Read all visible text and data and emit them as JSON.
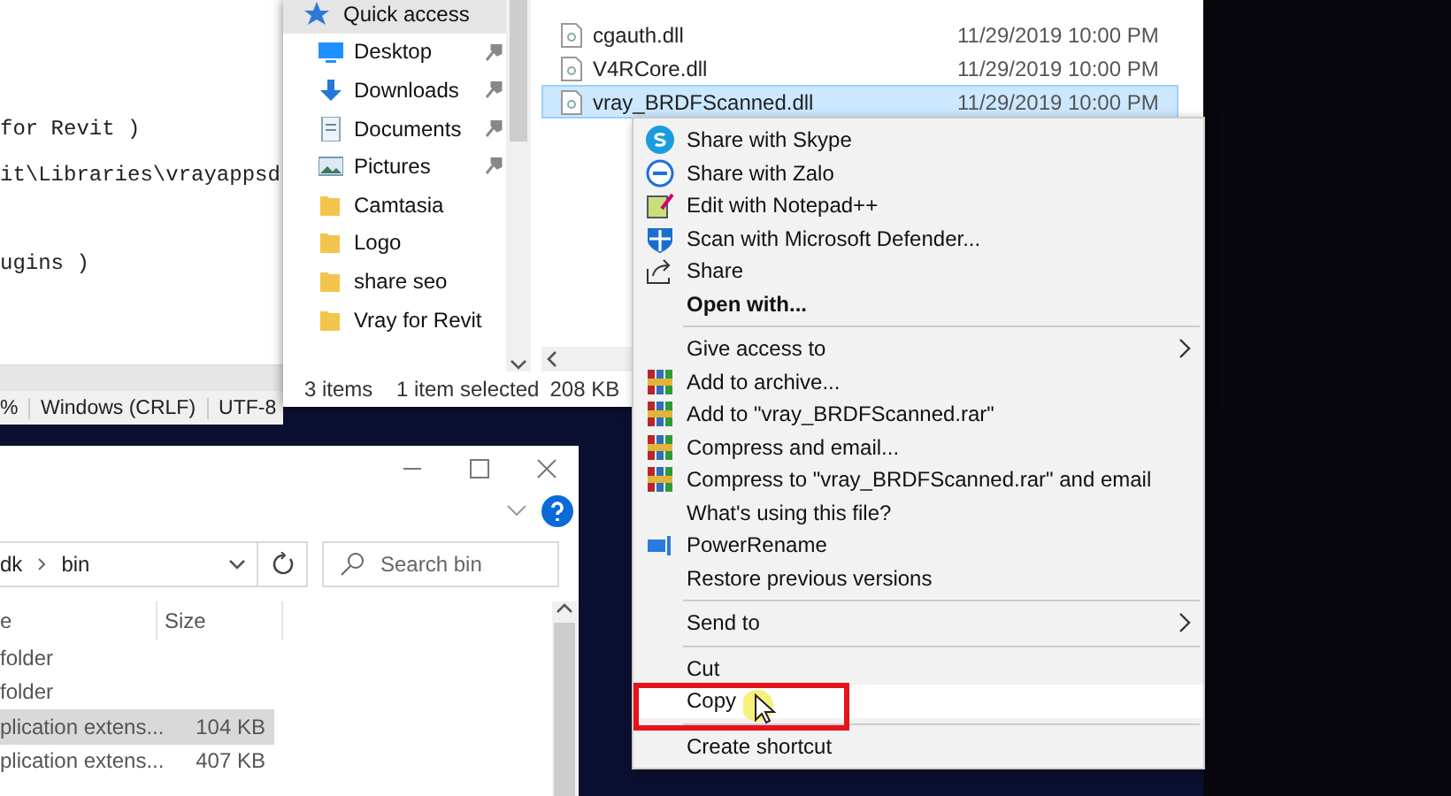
{
  "editor": {
    "lines": [
      "for Revit )",
      "it\\Libraries\\vrayappsd",
      "ugins )"
    ],
    "status_bar": [
      "%",
      "Windows (CRLF)",
      "UTF-8"
    ]
  },
  "explorer": {
    "nav": [
      {
        "label": "Quick access",
        "pinned": false,
        "selected": true
      },
      {
        "label": "Desktop",
        "pinned": true,
        "selected": false
      },
      {
        "label": "Downloads",
        "pinned": true,
        "selected": false
      },
      {
        "label": "Documents",
        "pinned": true,
        "selected": false
      },
      {
        "label": "Pictures",
        "pinned": true,
        "selected": false
      },
      {
        "label": "Camtasia",
        "pinned": false,
        "selected": false
      },
      {
        "label": "Logo",
        "pinned": false,
        "selected": false
      },
      {
        "label": "share seo",
        "pinned": false,
        "selected": false
      },
      {
        "label": "Vray for Revit",
        "pinned": false,
        "selected": false
      }
    ],
    "files": [
      {
        "name": "cgauth.dll",
        "date": "11/29/2019 10:00 PM",
        "selected": false
      },
      {
        "name": "V4RCore.dll",
        "date": "11/29/2019 10:00 PM",
        "selected": false
      },
      {
        "name": "vray_BRDFScanned.dll",
        "date": "11/29/2019 10:00 PM",
        "selected": true
      }
    ],
    "status_bar": {
      "count": "3 items",
      "selection": "1 item selected",
      "size": "208 KB"
    }
  },
  "context_menu": {
    "items": [
      {
        "kind": "item",
        "label": "Share with Skype",
        "bold": false,
        "submenu": false,
        "selected": false
      },
      {
        "kind": "item",
        "label": "Share with Zalo",
        "bold": false,
        "submenu": false,
        "selected": false
      },
      {
        "kind": "item",
        "label": "Edit with Notepad++",
        "bold": false,
        "submenu": false,
        "selected": false
      },
      {
        "kind": "item",
        "label": "Scan with Microsoft Defender...",
        "bold": false,
        "submenu": false,
        "selected": false
      },
      {
        "kind": "item",
        "label": "Share",
        "bold": false,
        "submenu": false,
        "selected": false
      },
      {
        "kind": "item",
        "label": "Open with...",
        "bold": true,
        "submenu": false,
        "selected": false
      },
      {
        "kind": "separator"
      },
      {
        "kind": "item",
        "label": "Give access to",
        "bold": false,
        "submenu": true,
        "selected": false
      },
      {
        "kind": "item",
        "label": "Add to archive...",
        "bold": false,
        "submenu": false,
        "selected": false
      },
      {
        "kind": "item",
        "label": "Add to \"vray_BRDFScanned.rar\"",
        "bold": false,
        "submenu": false,
        "selected": false
      },
      {
        "kind": "item",
        "label": "Compress and email...",
        "bold": false,
        "submenu": false,
        "selected": false
      },
      {
        "kind": "item",
        "label": "Compress to \"vray_BRDFScanned.rar\" and email",
        "bold": false,
        "submenu": false,
        "selected": false
      },
      {
        "kind": "item",
        "label": "What's using this file?",
        "bold": false,
        "submenu": false,
        "selected": false
      },
      {
        "kind": "item",
        "label": "PowerRename",
        "bold": false,
        "submenu": false,
        "selected": false
      },
      {
        "kind": "item",
        "label": "Restore previous versions",
        "bold": false,
        "submenu": false,
        "selected": false
      },
      {
        "kind": "separator"
      },
      {
        "kind": "item",
        "label": "Send to",
        "bold": false,
        "submenu": true,
        "selected": false
      },
      {
        "kind": "separator"
      },
      {
        "kind": "item",
        "label": "Cut",
        "bold": false,
        "submenu": false,
        "selected": false
      },
      {
        "kind": "item",
        "label": "Copy",
        "bold": false,
        "submenu": false,
        "selected": true
      },
      {
        "kind": "separator"
      },
      {
        "kind": "item",
        "label": "Create shortcut",
        "bold": false,
        "submenu": false,
        "selected": false
      }
    ]
  },
  "bin_window": {
    "address": [
      "dk",
      "bin"
    ],
    "search": {
      "placeholder": "Search bin"
    },
    "columns": [
      "e",
      "Size"
    ],
    "rows": [
      {
        "type": "folder",
        "selected": false
      },
      {
        "type": "folder",
        "selected": false
      },
      {
        "type": "plication extens...",
        "size": "104 KB",
        "selected": true
      },
      {
        "type": "plication extens...",
        "size": "407 KB",
        "selected": false
      }
    ]
  }
}
